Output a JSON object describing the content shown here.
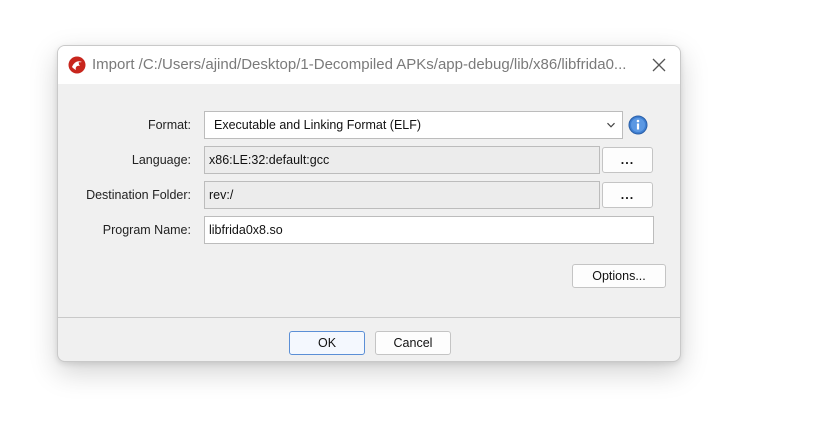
{
  "dialog": {
    "title": "Import /C:/Users/ajind/Desktop/1-Decompiled APKs/app-debug/lib/x86/libfrida0...",
    "app_icon": "ghidra-dragon-icon",
    "close_icon": "close-icon"
  },
  "form": {
    "format_label": "Format:",
    "format_value": "Executable and Linking Format (ELF)",
    "language_label": "Language:",
    "language_value": "x86:LE:32:default:gcc",
    "language_browse": "...",
    "destination_label": "Destination Folder:",
    "destination_value": "rev:/",
    "destination_browse": "...",
    "program_name_label": "Program Name:",
    "program_name_value": "libfrida0x8.so",
    "options_label": "Options..."
  },
  "footer": {
    "ok_label": "OK",
    "cancel_label": "Cancel"
  },
  "colors": {
    "accent": "#5b8fd6",
    "info_icon": "#3f7fd1",
    "app_icon_red": "#c8261d"
  }
}
